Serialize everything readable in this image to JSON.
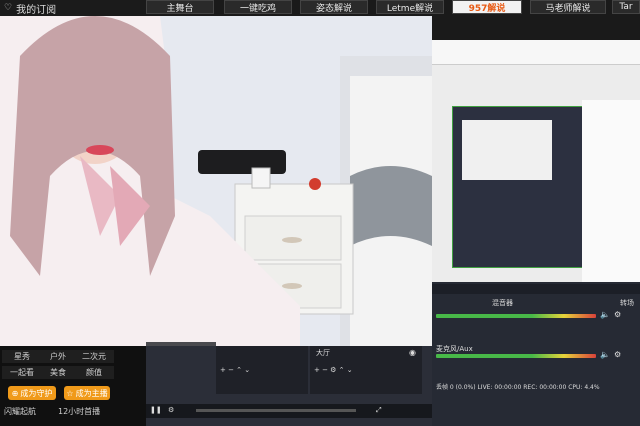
{
  "header": {
    "subscription_label": "我的订阅",
    "tabs": [
      {
        "label": "主舞台",
        "active": false
      },
      {
        "label": "一键吃鸡",
        "active": false
      },
      {
        "label": "姿态解说",
        "active": false
      },
      {
        "label": "Letme解说",
        "active": false
      },
      {
        "label": "957解说",
        "active": true
      },
      {
        "label": "马老师解说",
        "active": false
      },
      {
        "label": "Tar",
        "active": false
      }
    ]
  },
  "categories": [
    "星秀",
    "户外",
    "二次元",
    "一起看",
    "美食",
    "颜值"
  ],
  "actions": {
    "follow_label": "成为守护",
    "fan_label": "成为主播"
  },
  "footer": {
    "left_text": "闪耀起航",
    "right_text": "12小时首播"
  },
  "obs": {
    "scene_title": "大厅",
    "mixer_title": "混音器",
    "track_label": "麦克风/Aux",
    "side_title": "转场",
    "stats_text": "丢帧 0 (0.0%)   LIVE: 00:00:00   REC: 00:00:00   CPU: 4.4%"
  },
  "colors": {
    "accent": "#e85a14",
    "orange": "#f09a1a",
    "meter_green": "#48b848",
    "obs_dark": "#262a34"
  }
}
